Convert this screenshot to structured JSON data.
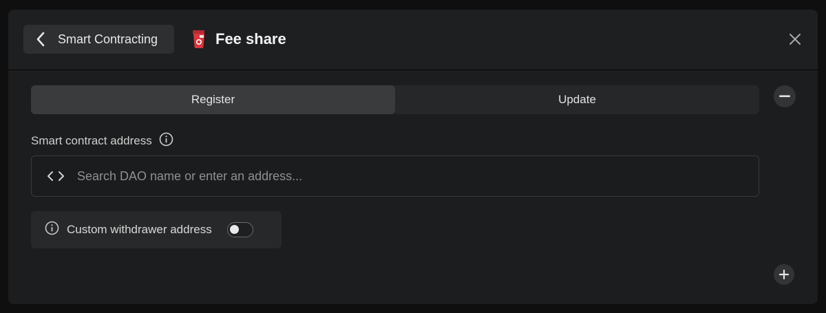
{
  "header": {
    "back_label": "Smart Contracting",
    "title": "Fee share",
    "logo_icon": "fee-share-logo-icon",
    "close_icon": "close-icon"
  },
  "tabs": [
    {
      "label": "Register",
      "active": true
    },
    {
      "label": "Update",
      "active": false
    }
  ],
  "contract_address": {
    "label": "Smart contract address",
    "placeholder": "Search DAO name or enter an address...",
    "value": ""
  },
  "custom_withdrawer": {
    "label": "Custom withdrawer address",
    "enabled": false
  },
  "colors": {
    "background": "#0f0f10",
    "panel": "#1c1d1e",
    "active_tab": "#3a3b3d",
    "logo_red": "#d9363e"
  }
}
